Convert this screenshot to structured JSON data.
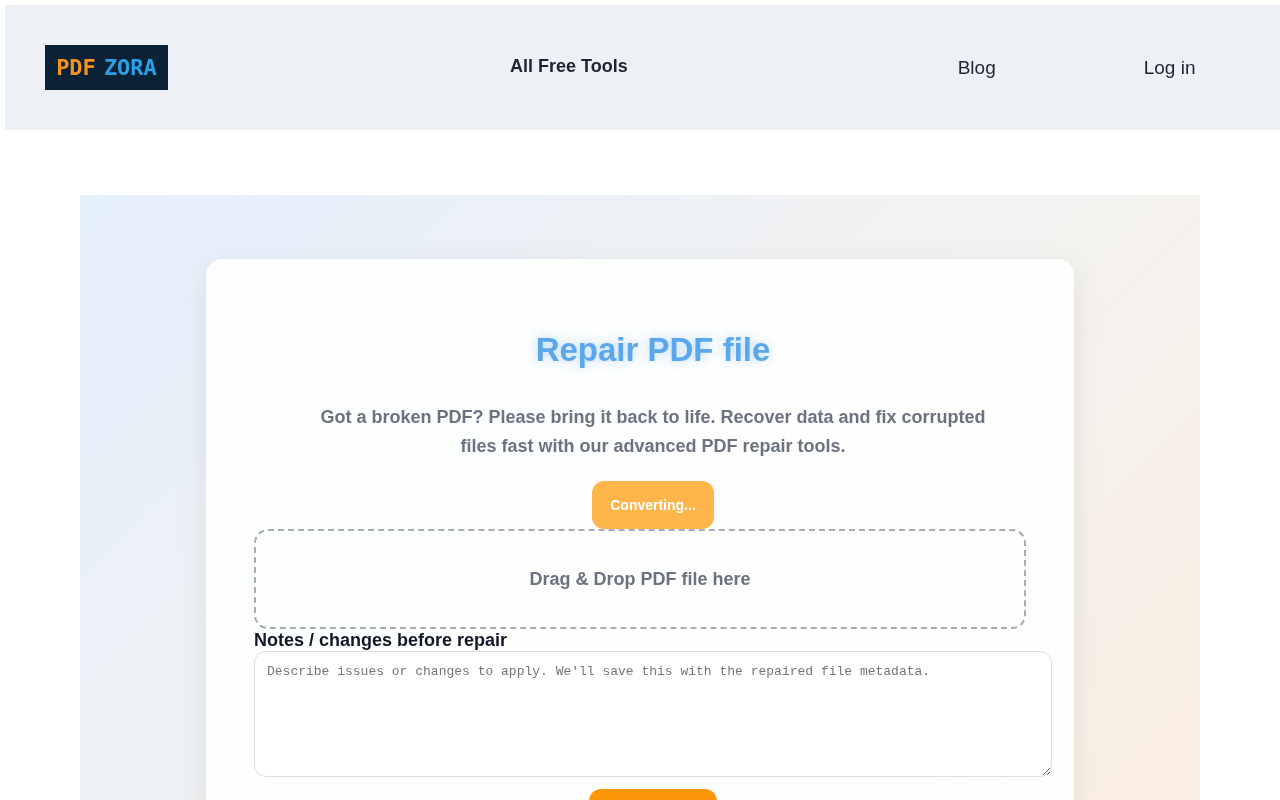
{
  "header": {
    "logo": {
      "part_1": "PDF",
      "part_2": "ZORA"
    },
    "nav": [
      "All Free Tools",
      "Blog",
      "Log in"
    ]
  },
  "tool": {
    "title": "Repair PDF file",
    "description": "Got a broken PDF? Please bring it back to life. Recover data and fix corrupted files fast with our advanced PDF repair tools.",
    "status_button": "Converting...",
    "dropzone": "Drag & Drop PDF file here",
    "notes": {
      "label": "Notes / changes before repair",
      "placeholder": "Describe issues or changes to apply. We'll save this with the repaired file metadata."
    }
  }
}
